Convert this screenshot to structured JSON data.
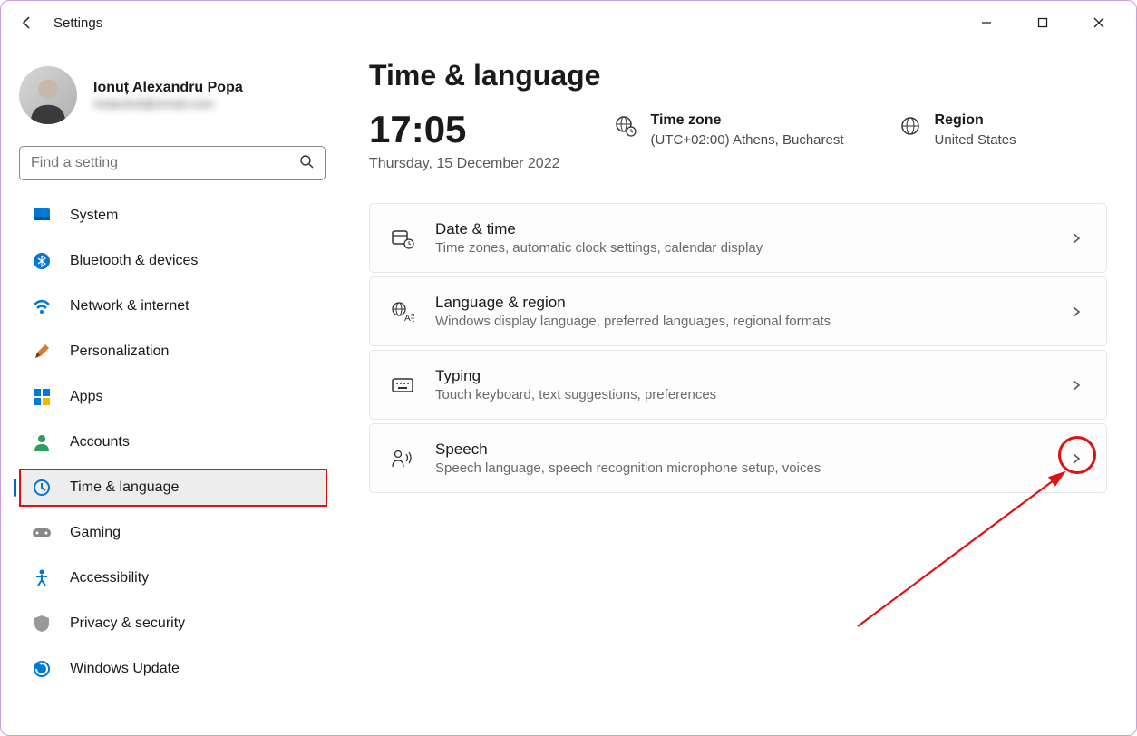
{
  "app": {
    "title": "Settings"
  },
  "profile": {
    "name": "Ionuț Alexandru Popa",
    "email": "redacted@email.com"
  },
  "search": {
    "placeholder": "Find a setting"
  },
  "sidebar": {
    "items": [
      {
        "label": "System"
      },
      {
        "label": "Bluetooth & devices"
      },
      {
        "label": "Network & internet"
      },
      {
        "label": "Personalization"
      },
      {
        "label": "Apps"
      },
      {
        "label": "Accounts"
      },
      {
        "label": "Time & language"
      },
      {
        "label": "Gaming"
      },
      {
        "label": "Accessibility"
      },
      {
        "label": "Privacy & security"
      },
      {
        "label": "Windows Update"
      }
    ]
  },
  "page": {
    "title": "Time & language",
    "time": "17:05",
    "date": "Thursday, 15 December 2022",
    "timezone_label": "Time zone",
    "timezone_value": "(UTC+02:00) Athens, Bucharest",
    "region_label": "Region",
    "region_value": "United States"
  },
  "cards": [
    {
      "title": "Date & time",
      "sub": "Time zones, automatic clock settings, calendar display"
    },
    {
      "title": "Language & region",
      "sub": "Windows display language, preferred languages, regional formats"
    },
    {
      "title": "Typing",
      "sub": "Touch keyboard, text suggestions, preferences"
    },
    {
      "title": "Speech",
      "sub": "Speech language, speech recognition microphone setup, voices"
    }
  ]
}
